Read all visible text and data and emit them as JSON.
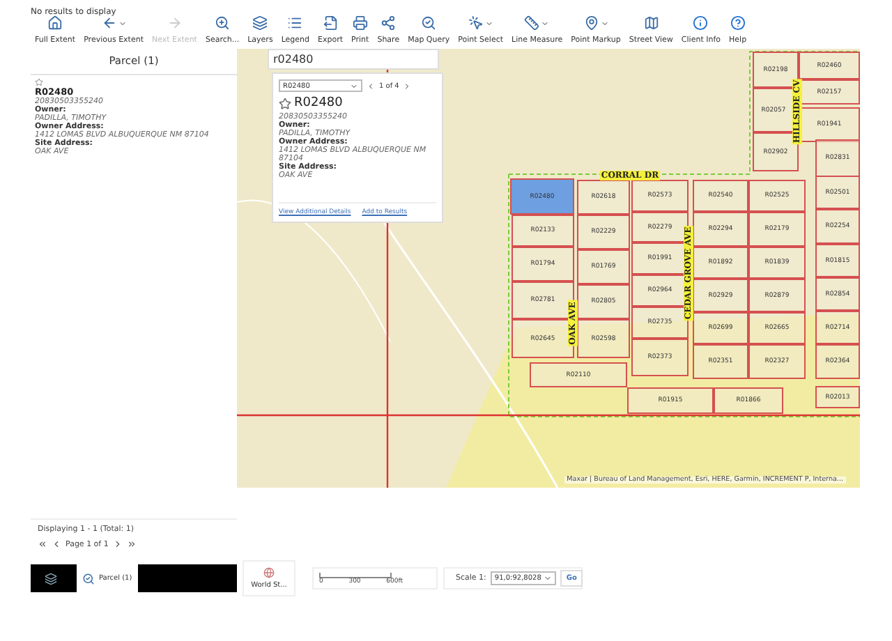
{
  "header": {
    "status": "No results to display"
  },
  "toolbar": [
    {
      "label": "Full Extent",
      "kind": "home",
      "dropdown": false,
      "disabled": false
    },
    {
      "label": "Previous Extent",
      "kind": "back",
      "dropdown": true,
      "disabled": false
    },
    {
      "label": "Next Extent",
      "kind": "forward",
      "dropdown": false,
      "disabled": true
    },
    {
      "label": "Search...",
      "kind": "search",
      "dropdown": false,
      "disabled": false
    },
    {
      "label": "Layers",
      "kind": "layers",
      "dropdown": false,
      "disabled": false
    },
    {
      "label": "Legend",
      "kind": "legend",
      "dropdown": false,
      "disabled": false
    },
    {
      "label": "Export",
      "kind": "export",
      "dropdown": false,
      "disabled": false
    },
    {
      "label": "Print",
      "kind": "print",
      "dropdown": false,
      "disabled": false
    },
    {
      "label": "Share",
      "kind": "share",
      "dropdown": false,
      "disabled": false
    },
    {
      "label": "Map Query",
      "kind": "query",
      "dropdown": false,
      "disabled": false
    },
    {
      "label": "Point Select",
      "kind": "select",
      "dropdown": true,
      "disabled": false
    },
    {
      "label": "Line Measure",
      "kind": "measure",
      "dropdown": true,
      "disabled": false
    },
    {
      "label": "Point Markup",
      "kind": "markup",
      "dropdown": true,
      "disabled": false
    },
    {
      "label": "Street View",
      "kind": "street",
      "dropdown": false,
      "disabled": false
    },
    {
      "label": "Client Info",
      "kind": "info",
      "dropdown": false,
      "disabled": false
    },
    {
      "label": "Help",
      "kind": "help",
      "dropdown": false,
      "disabled": false
    }
  ],
  "left_panel": {
    "title": "Parcel (1)",
    "result": {
      "parcel": "R02480",
      "id": "20830503355240",
      "fields": [
        {
          "label": "Owner:",
          "value": "PADILLA, TIMOTHY"
        },
        {
          "label": "Owner Address:",
          "value": "1412 LOMAS BLVD ALBUQUERQUE NM 87104"
        },
        {
          "label": "Site Address:",
          "value": "OAK AVE"
        }
      ]
    },
    "summary": "Displaying 1 - 1 (Total: 1)",
    "page": "Page 1 of 1"
  },
  "search": {
    "value": "r02480"
  },
  "popup": {
    "select": "R02480",
    "counter": "1 of 4",
    "title": "R02480",
    "id": "20830503355240",
    "fields": [
      {
        "label": "Owner:",
        "value": "PADILLA, TIMOTHY"
      },
      {
        "label": "Owner Address:",
        "value": "1412 LOMAS BLVD ALBUQUERQUE NM 87104"
      },
      {
        "label": "Site Address:",
        "value": "OAK AVE"
      }
    ],
    "links": [
      "View Additional Details",
      "Add to Results"
    ]
  },
  "map": {
    "parcels": [
      {
        "label": "R02480",
        "selected": true
      },
      {
        "label": "R02133",
        "selected": false
      },
      {
        "label": "R01794",
        "selected": false
      },
      {
        "label": "R02781",
        "selected": false
      },
      {
        "label": "R02645",
        "selected": false
      },
      {
        "label": "R02618",
        "selected": false
      },
      {
        "label": "R02229",
        "selected": false
      },
      {
        "label": "R01769",
        "selected": false
      },
      {
        "label": "R02805",
        "selected": false
      },
      {
        "label": "R02598",
        "selected": false
      },
      {
        "label": "R02573",
        "selected": false
      },
      {
        "label": "R02279",
        "selected": false
      },
      {
        "label": "R01991",
        "selected": false
      },
      {
        "label": "R02964",
        "selected": false
      },
      {
        "label": "R02735",
        "selected": false
      },
      {
        "label": "R02373",
        "selected": false
      },
      {
        "label": "R02540",
        "selected": false
      },
      {
        "label": "R02294",
        "selected": false
      },
      {
        "label": "R01892",
        "selected": false
      },
      {
        "label": "R02929",
        "selected": false
      },
      {
        "label": "R02699",
        "selected": false
      },
      {
        "label": "R02351",
        "selected": false
      },
      {
        "label": "R02525",
        "selected": false
      },
      {
        "label": "R02179",
        "selected": false
      },
      {
        "label": "R01839",
        "selected": false
      },
      {
        "label": "R02879",
        "selected": false
      },
      {
        "label": "R02665",
        "selected": false
      },
      {
        "label": "R02327",
        "selected": false
      },
      {
        "label": "R02501",
        "selected": false
      },
      {
        "label": "R02254",
        "selected": false
      },
      {
        "label": "R01815",
        "selected": false
      },
      {
        "label": "R02854",
        "selected": false
      },
      {
        "label": "R02714",
        "selected": false
      },
      {
        "label": "R02364",
        "selected": false
      },
      {
        "label": "R02013",
        "selected": false
      },
      {
        "label": "R02110",
        "selected": false
      },
      {
        "label": "R01915",
        "selected": false
      },
      {
        "label": "R01866",
        "selected": false
      },
      {
        "label": "R02198",
        "selected": false
      },
      {
        "label": "R02460",
        "selected": false
      },
      {
        "label": "R02157",
        "selected": false
      },
      {
        "label": "R02057",
        "selected": false
      },
      {
        "label": "R01941",
        "selected": false
      },
      {
        "label": "R02902",
        "selected": false
      },
      {
        "label": "R02831",
        "selected": false
      }
    ],
    "streets": [
      {
        "label": "CORRAL DR",
        "kind": "horizontal"
      },
      {
        "label": "OAK AVE",
        "kind": "vertical"
      },
      {
        "label": "CEDAR GROVE AVE",
        "kind": "vertical"
      },
      {
        "label": "HILLSIDE CV",
        "kind": "vertical"
      }
    ],
    "attribution": "Maxar | Bureau of Land Management, Esri, HERE, Garmin, INCREMENT P, Interna..."
  },
  "taskbar": [
    {
      "kind": "layers",
      "selected": false
    },
    {
      "kind": "query",
      "label": "Parcel (1)",
      "selected": true
    }
  ],
  "basemap": {
    "label": "World St..."
  },
  "scalebar": [
    "0",
    "300",
    "600ft"
  ],
  "scale": {
    "label": "Scale 1:",
    "value": "91,0:92,8028",
    "button": "Go"
  }
}
